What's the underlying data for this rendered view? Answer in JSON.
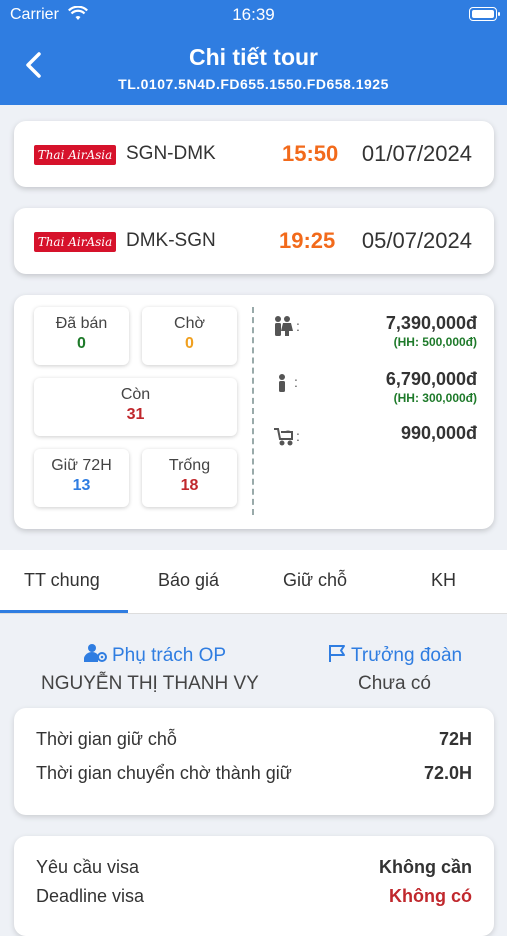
{
  "status_bar": {
    "carrier": "Carrier",
    "time": "16:39"
  },
  "header": {
    "title": "Chi tiết tour",
    "subtitle": "TL.0107.5N4D.FD655.1550.FD658.1925"
  },
  "flights": [
    {
      "airline_logo": "Thai AirAsia",
      "route": "SGN-DMK",
      "time": "15:50",
      "date": "01/07/2024"
    },
    {
      "airline_logo": "Thai AirAsia",
      "route": "DMK-SGN",
      "time": "19:25",
      "date": "05/07/2024"
    }
  ],
  "seats": {
    "sold": {
      "label": "Đã bán",
      "value": "0"
    },
    "waiting": {
      "label": "Chờ",
      "value": "0"
    },
    "remaining": {
      "label": "Còn",
      "value": "31"
    },
    "held_72h": {
      "label": "Giữ 72H",
      "value": "13"
    },
    "empty": {
      "label": "Trống",
      "value": "18"
    }
  },
  "prices": {
    "adult": {
      "price": "7,390,000đ",
      "commission": "(HH: 500,000đ)",
      "icon": "adults-icon"
    },
    "child": {
      "price": "6,790,000đ",
      "commission": "(HH: 300,000đ)",
      "icon": "child-icon"
    },
    "infant": {
      "price": "990,000đ",
      "icon": "stroller-icon"
    }
  },
  "tabs": [
    "TT chung",
    "Báo giá",
    "Giữ chỗ",
    "KH"
  ],
  "active_tab": "TT chung",
  "op": {
    "op_label": "Phụ trách OP",
    "op_name": "NGUYỄN THỊ THANH VY",
    "leader_label": "Trưởng đoàn",
    "leader_name": "Chưa có"
  },
  "hold_info": [
    {
      "label": "Thời gian giữ chỗ",
      "value": "72H"
    },
    {
      "label": "Thời gian chuyển chờ thành giữ",
      "value": "72.0H"
    }
  ],
  "visa_info": [
    {
      "label": "Yêu cầu visa",
      "value": "Không cần"
    },
    {
      "label": "Deadline visa",
      "value": "Không có"
    }
  ],
  "colors": {
    "primary": "#2f7de1",
    "orange": "#f26a1b",
    "green": "#1e7a2a",
    "red": "#c0282d"
  }
}
